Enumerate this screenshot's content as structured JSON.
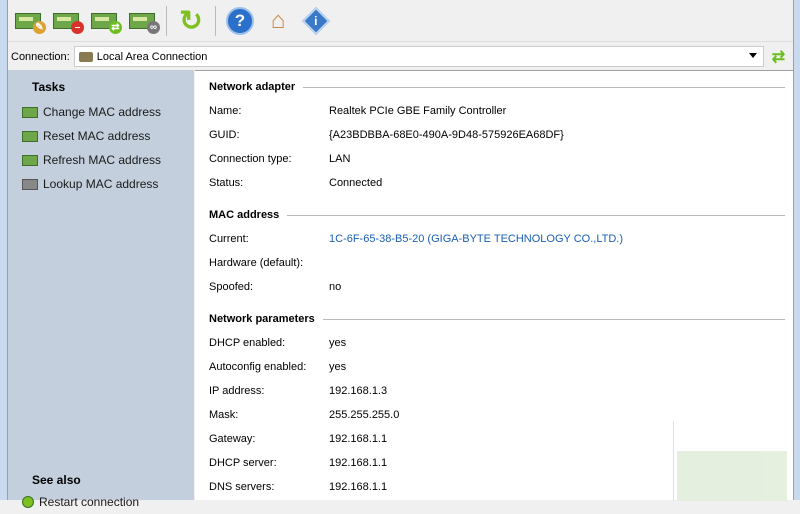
{
  "toolbar": {
    "buttons": [
      "change-mac",
      "reset-mac",
      "refresh-mac",
      "lookup-mac",
      "refresh",
      "help",
      "home",
      "about"
    ]
  },
  "connection": {
    "label": "Connection:",
    "value": "Local Area Connection"
  },
  "sidebar": {
    "tasks_title": "Tasks",
    "tasks": [
      {
        "label": "Change MAC address"
      },
      {
        "label": "Reset MAC address"
      },
      {
        "label": "Refresh MAC address"
      },
      {
        "label": "Lookup MAC address"
      }
    ],
    "see_also_title": "See also",
    "see_also": [
      {
        "label": "Restart connection"
      }
    ]
  },
  "adapter": {
    "title": "Network adapter",
    "rows": [
      {
        "k": "Name:",
        "v": "Realtek PCIe GBE Family Controller"
      },
      {
        "k": "GUID:",
        "v": "{A23BDBBA-68E0-490A-9D48-575926EA68DF}"
      },
      {
        "k": "Connection type:",
        "v": "LAN"
      },
      {
        "k": "Status:",
        "v": "Connected"
      }
    ]
  },
  "mac": {
    "title": "MAC address",
    "rows": [
      {
        "k": "Current:",
        "v": "1C-6F-65-38-B5-20 (GIGA-BYTE TECHNOLOGY CO.,LTD.)"
      },
      {
        "k": "Hardware (default):",
        "v": ""
      },
      {
        "k": "Spoofed:",
        "v": "no"
      }
    ]
  },
  "params": {
    "title": "Network parameters",
    "rows": [
      {
        "k": "DHCP enabled:",
        "v": "yes"
      },
      {
        "k": "Autoconfig enabled:",
        "v": "yes"
      },
      {
        "k": "IP address:",
        "v": "192.168.1.3"
      },
      {
        "k": "Mask:",
        "v": "255.255.255.0"
      },
      {
        "k": "Gateway:",
        "v": "192.168.1.1"
      },
      {
        "k": "DHCP server:",
        "v": "192.168.1.1"
      },
      {
        "k": "DNS servers:",
        "v": "192.168.1.1"
      }
    ]
  }
}
